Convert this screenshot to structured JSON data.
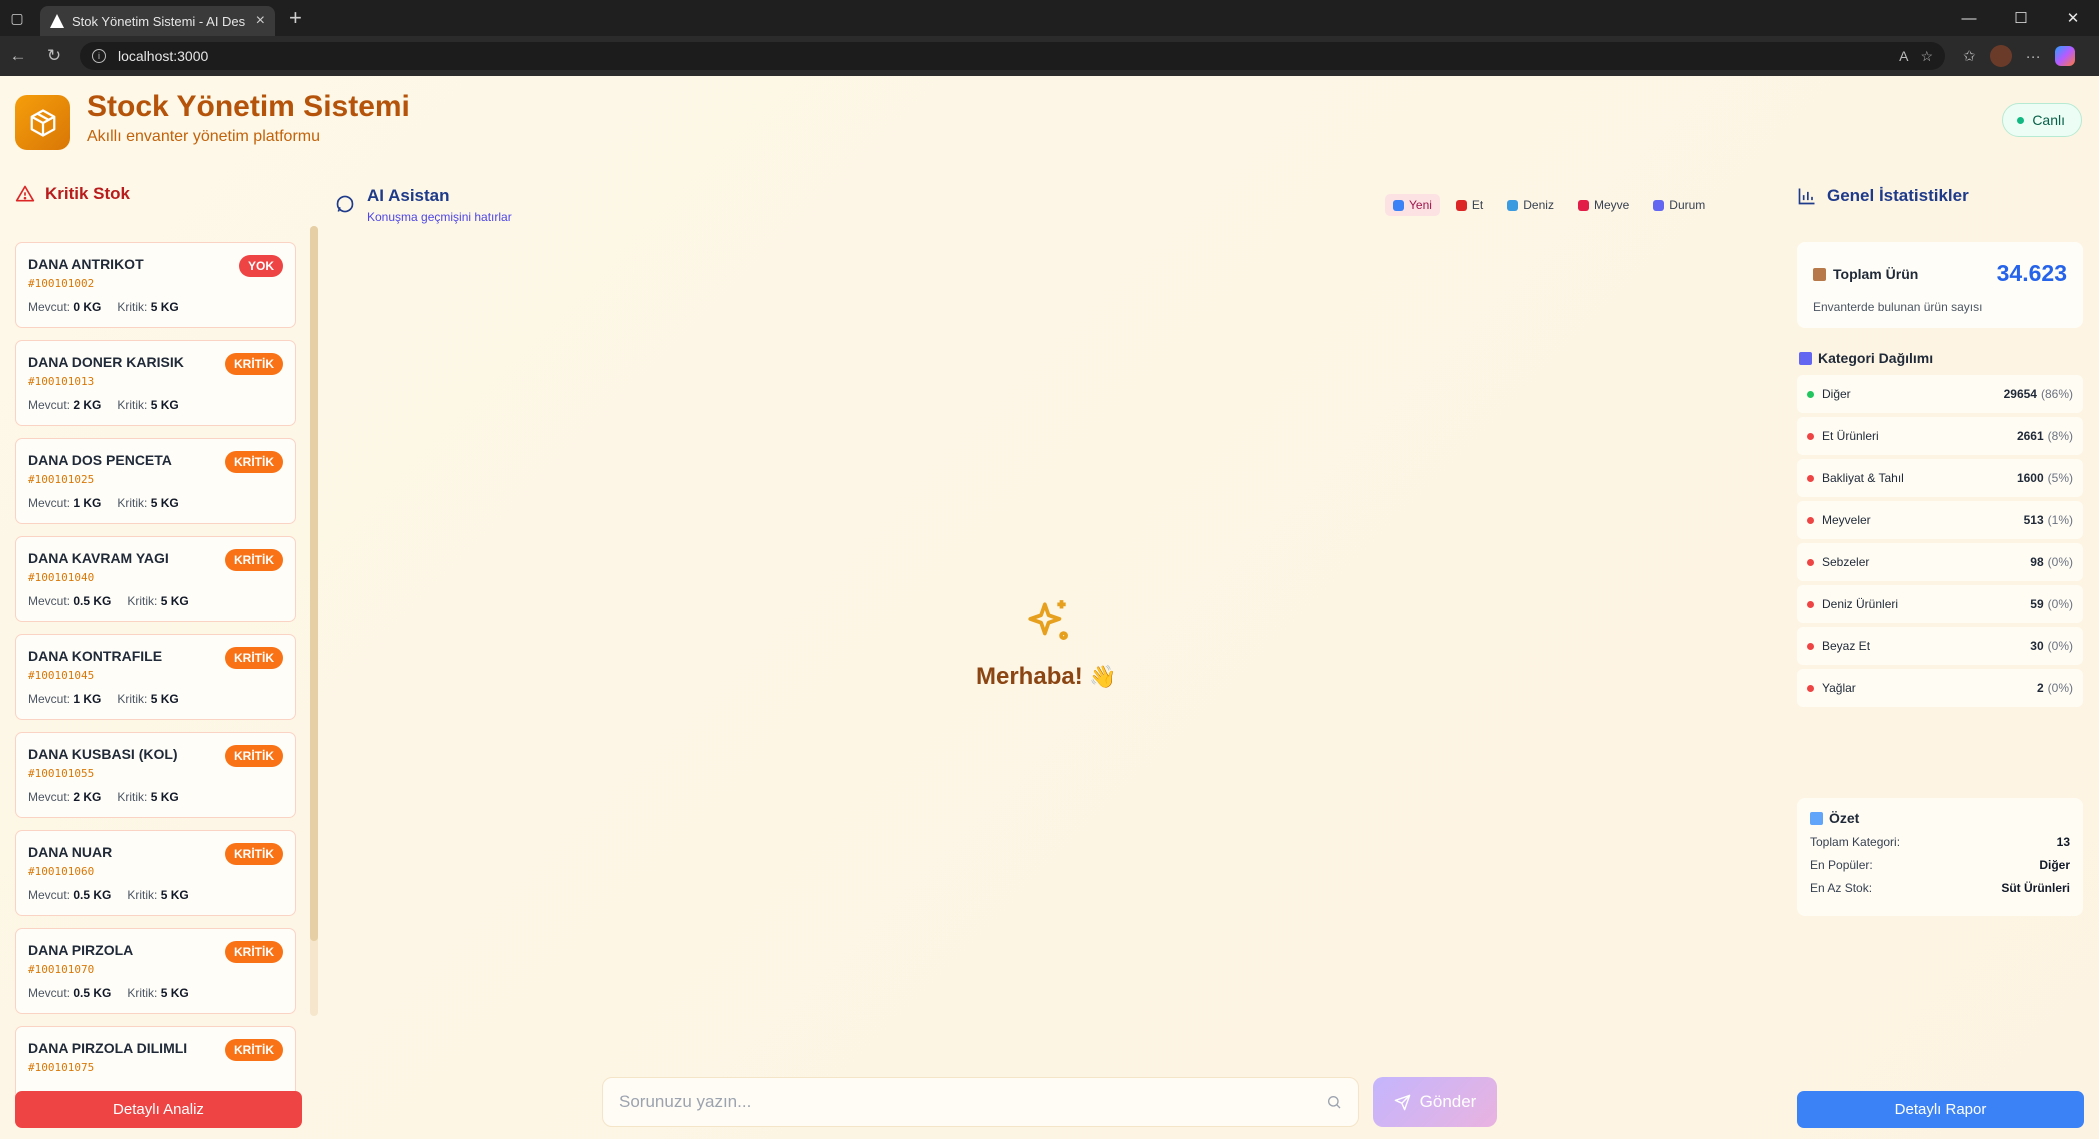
{
  "browser": {
    "tab_title": "Stok Yönetim Sistemi - AI Des",
    "url": "localhost:3000"
  },
  "header": {
    "title_a": "Stock",
    "title_b": "Yönetim Sistemi",
    "subtitle": "Akıllı envanter yönetim platformu",
    "live_label": "Canlı"
  },
  "critical": {
    "heading": "Kritik Stok",
    "mevcut_label": "Mevcut:",
    "kritik_label": "Kritik:",
    "items": [
      {
        "name": "DANA ANTRIKOT",
        "code": "#100101002",
        "current": "0 KG",
        "critical": "5 KG",
        "badge": "YOK"
      },
      {
        "name": "DANA DONER KARISIK",
        "code": "#100101013",
        "current": "2 KG",
        "critical": "5 KG",
        "badge": "KRİTİK"
      },
      {
        "name": "DANA DOS PENCETA",
        "code": "#100101025",
        "current": "1 KG",
        "critical": "5 KG",
        "badge": "KRİTİK"
      },
      {
        "name": "DANA KAVRAM YAGI",
        "code": "#100101040",
        "current": "0.5 KG",
        "critical": "5 KG",
        "badge": "KRİTİK"
      },
      {
        "name": "DANA KONTRAFILE",
        "code": "#100101045",
        "current": "1 KG",
        "critical": "5 KG",
        "badge": "KRİTİK"
      },
      {
        "name": "DANA KUSBASI (KOL)",
        "code": "#100101055",
        "current": "2 KG",
        "critical": "5 KG",
        "badge": "KRİTİK"
      },
      {
        "name": "DANA NUAR",
        "code": "#100101060",
        "current": "0.5 KG",
        "critical": "5 KG",
        "badge": "KRİTİK"
      },
      {
        "name": "DANA PIRZOLA",
        "code": "#100101070",
        "current": "0.5 KG",
        "critical": "5 KG",
        "badge": "KRİTİK"
      },
      {
        "name": "DANA PIRZOLA DILIMLI",
        "code": "#100101075",
        "current": "",
        "critical": "",
        "badge": "KRİTİK"
      }
    ],
    "button": "Detaylı Analiz"
  },
  "assistant": {
    "title": "AI Asistan",
    "subtitle": "Konuşma geçmişini hatırlar",
    "quick": [
      {
        "label": "Yeni",
        "icon": "refresh-icon",
        "color": "#3b82f6"
      },
      {
        "label": "Et",
        "icon": "meat-icon",
        "color": "#dc2626"
      },
      {
        "label": "Deniz",
        "icon": "fish-icon",
        "color": "#3b9be0"
      },
      {
        "label": "Meyve",
        "icon": "apple-icon",
        "color": "#e11d48"
      },
      {
        "label": "Durum",
        "icon": "chart-icon",
        "color": "#6366f1"
      }
    ],
    "welcome": "Merhaba!",
    "wave": "👋",
    "placeholder": "Sorunuzu yazın...",
    "send": "Gönder"
  },
  "stats": {
    "heading": "Genel İstatistikler",
    "total_label": "Toplam Ürün",
    "total_value": "34.623",
    "total_sub": "Envanterde bulunan ürün sayısı",
    "cat_heading": "Kategori Dağılımı",
    "categories": [
      {
        "name": "Diğer",
        "count": "29654",
        "pct": "(86%)",
        "color": "green"
      },
      {
        "name": "Et Ürünleri",
        "count": "2661",
        "pct": "(8%)",
        "color": "red"
      },
      {
        "name": "Bakliyat & Tahıl",
        "count": "1600",
        "pct": "(5%)",
        "color": "red"
      },
      {
        "name": "Meyveler",
        "count": "513",
        "pct": "(1%)",
        "color": "red"
      },
      {
        "name": "Sebzeler",
        "count": "98",
        "pct": "(0%)",
        "color": "red"
      },
      {
        "name": "Deniz Ürünleri",
        "count": "59",
        "pct": "(0%)",
        "color": "red"
      },
      {
        "name": "Beyaz Et",
        "count": "30",
        "pct": "(0%)",
        "color": "red"
      },
      {
        "name": "Yağlar",
        "count": "2",
        "pct": "(0%)",
        "color": "red"
      }
    ],
    "summary": {
      "heading": "Özet",
      "rows": [
        {
          "label": "Toplam Kategori:",
          "value": "13"
        },
        {
          "label": "En Popüler:",
          "value": "Diğer"
        },
        {
          "label": "En Az Stok:",
          "value": "Süt Ürünleri"
        }
      ]
    },
    "button": "Detaylı Rapor"
  }
}
